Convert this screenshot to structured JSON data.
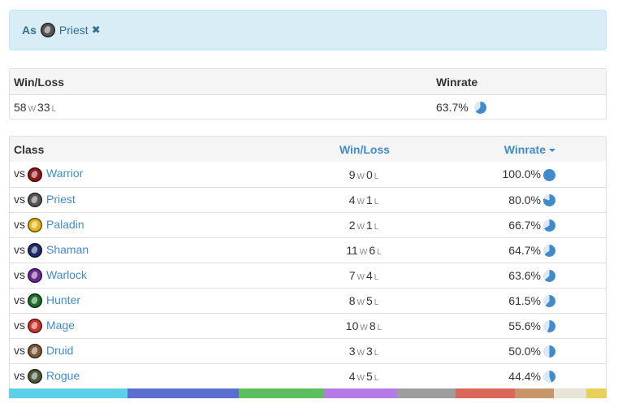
{
  "filter": {
    "as_label": "As",
    "class_name": "Priest",
    "icon": "priest-icon",
    "icon_color": "#555555",
    "remove_symbol": "✖"
  },
  "summary": {
    "headers": {
      "winloss": "Win/Loss",
      "winrate": "Winrate"
    },
    "wins": "58",
    "losses": "33",
    "w_suffix": "W",
    "l_suffix": "L",
    "winrate": "63.7%",
    "winrate_value": 63.7
  },
  "classes": {
    "headers": {
      "class": "Class",
      "winloss": "Win/Loss",
      "winrate": "Winrate"
    },
    "vs_label": "vs",
    "rows": [
      {
        "name": "Warrior",
        "icon": "warrior-icon",
        "color": "#8b1a1a",
        "wins": "9",
        "losses": "0",
        "winrate": "100.0%",
        "value": 100.0
      },
      {
        "name": "Priest",
        "icon": "priest-icon",
        "color": "#555555",
        "wins": "4",
        "losses": "1",
        "winrate": "80.0%",
        "value": 80.0
      },
      {
        "name": "Paladin",
        "icon": "paladin-icon",
        "color": "#e2b31a",
        "wins": "2",
        "losses": "1",
        "winrate": "66.7%",
        "value": 66.7
      },
      {
        "name": "Shaman",
        "icon": "shaman-icon",
        "color": "#1f2a6b",
        "wins": "11",
        "losses": "6",
        "winrate": "64.7%",
        "value": 64.7
      },
      {
        "name": "Warlock",
        "icon": "warlock-icon",
        "color": "#6b2a8f",
        "wins": "7",
        "losses": "4",
        "winrate": "63.6%",
        "value": 63.6
      },
      {
        "name": "Hunter",
        "icon": "hunter-icon",
        "color": "#1e6b2a",
        "wins": "8",
        "losses": "5",
        "winrate": "61.5%",
        "value": 61.5
      },
      {
        "name": "Mage",
        "icon": "mage-icon",
        "color": "#c6362e",
        "wins": "10",
        "losses": "8",
        "winrate": "55.6%",
        "value": 55.6
      },
      {
        "name": "Druid",
        "icon": "druid-icon",
        "color": "#7a5a3a",
        "wins": "3",
        "losses": "3",
        "winrate": "50.0%",
        "value": 50.0
      },
      {
        "name": "Rogue",
        "icon": "rogue-icon",
        "color": "#4a5a3a",
        "wins": "4",
        "losses": "5",
        "winrate": "44.4%",
        "value": 44.4
      }
    ]
  },
  "pie_colors": {
    "fill": "#428bca",
    "empty": "#dbe9f6"
  },
  "colorbar": [
    {
      "color": "#5bd0e6",
      "share": 146
    },
    {
      "color": "#5a6fcf",
      "share": 137
    },
    {
      "color": "#5cbe5c",
      "share": 105
    },
    {
      "color": "#b67ae6",
      "share": 90
    },
    {
      "color": "#9e9e9e",
      "share": 72
    },
    {
      "color": "#d9685a",
      "share": 73
    },
    {
      "color": "#c8946a",
      "share": 48
    },
    {
      "color": "#e8e4d8",
      "share": 40
    },
    {
      "color": "#e8d05a",
      "share": 25
    }
  ]
}
